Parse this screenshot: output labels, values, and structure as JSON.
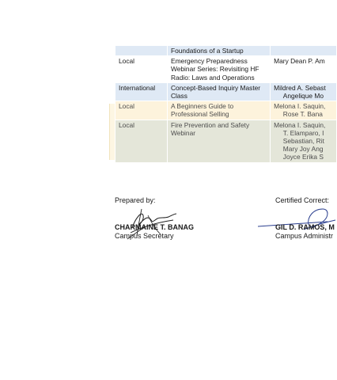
{
  "table": {
    "rows": [
      {
        "style": "blue",
        "level": "",
        "title": "Foundations of a Startup",
        "people": ""
      },
      {
        "style": "white",
        "level": "Local",
        "title": "Emergency Preparedness Webinar Series: Revisiting HF Radio: Laws and Operations",
        "people": "Mary Dean P. Am"
      },
      {
        "style": "blue",
        "level": "International",
        "title": "Concept-Based Inquiry Master Class",
        "people": "Mildred A. Sebast\n     Angelique Mo"
      },
      {
        "style": "cream",
        "level": "Local",
        "title": "A Beginners Guide to Professional Selling",
        "people": "Melona I. Saquin,\n     Rose T. Bana"
      },
      {
        "style": "gray",
        "level": "Local",
        "title": "Fire Prevention and Safety Webinar",
        "people": "Melona I. Saquin,\n     T. Elamparo, I\n     Sebastian, Rit\n     Mary Joy Ang\n     Joyce Erika S"
      }
    ]
  },
  "signatories": {
    "left": {
      "label": "Prepared by:",
      "name": "CHARMAINE T. BANAG",
      "role": "Campus Secretary"
    },
    "right": {
      "label": "Certified Correct:",
      "name": "GIL D. RAMOS, M",
      "role": "Campus Administr"
    }
  }
}
